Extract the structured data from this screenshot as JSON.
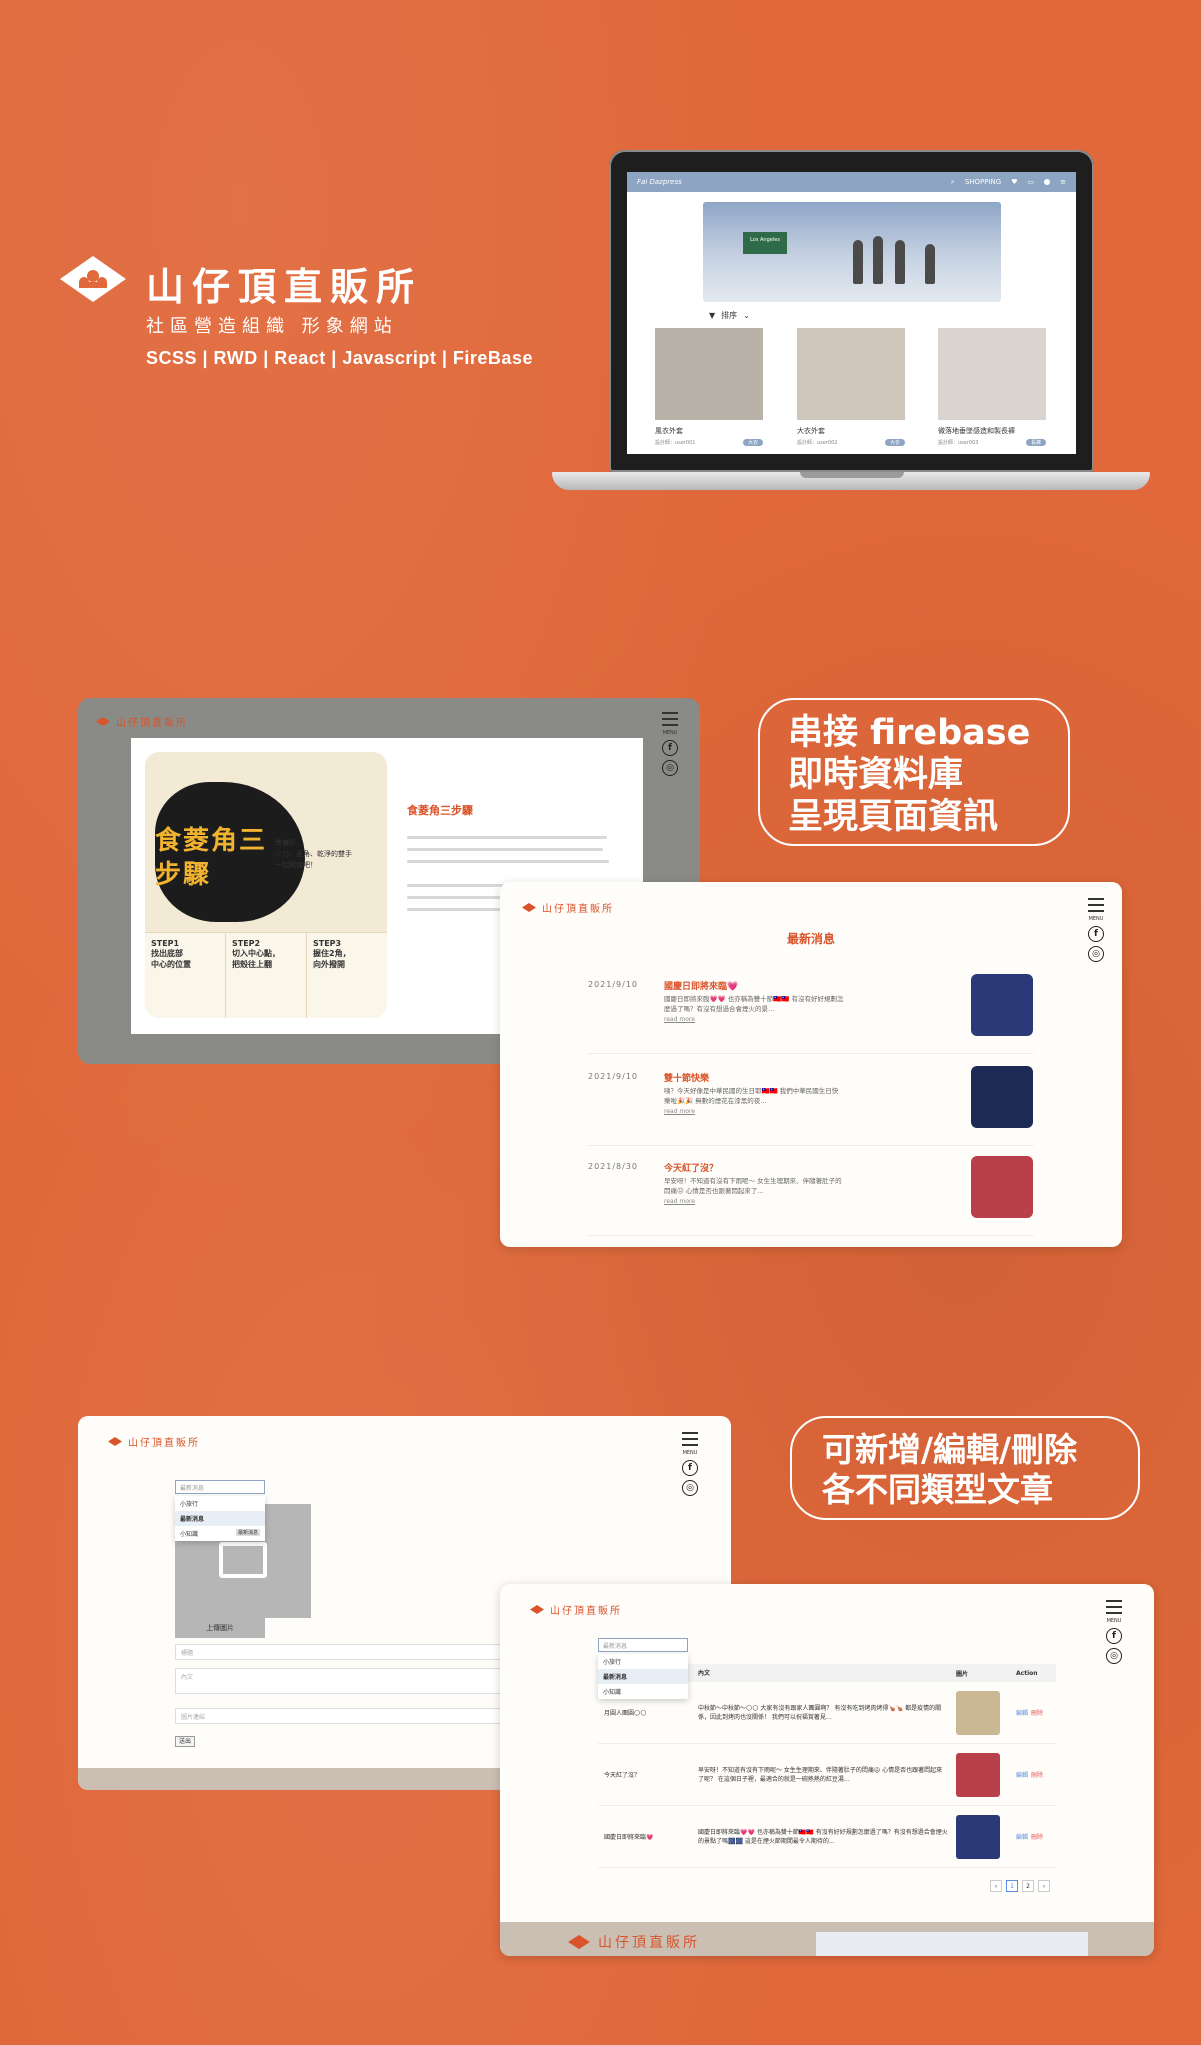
{
  "brand": {
    "title": "山仔頂直販所",
    "subtitle": "社區營造組織 形象網站",
    "tech": "SCSS | RWD | React | Javascript | FireBase"
  },
  "laptop": {
    "nav_logo": "Fai Dazpress",
    "nav_items": [
      "SHOPPING"
    ],
    "banner_sign": "Los Angeles",
    "filter_label": "排序",
    "cards": [
      {
        "name": "風衣外套",
        "designer": "設計師：user001",
        "tag": "大衣"
      },
      {
        "name": "大衣外套",
        "designer": "設計師：user002",
        "tag": "大衣"
      },
      {
        "name": "微落地垂墜感造和製長褲",
        "designer": "設計師：user003",
        "tag": "長褲"
      }
    ]
  },
  "section2": {
    "site_name": "山仔頂直販所",
    "menu_label": "MENU",
    "facebook_glyph": "f",
    "instagram_glyph": "◎",
    "food_card_title": "食菱角三步驟",
    "food_side_text": "準備好\n小刀、菱角、乾淨的雙手\n一起開始吧！",
    "steps": [
      "STEP1\n找出底部\n中心的位置",
      "STEP2\n切入中心點，\n把殼往上翻",
      "STEP3\n握住2角，\n向外撥開"
    ],
    "article_title": "食菱角三步驟",
    "callout": [
      "串接 firebase",
      "即時資料庫",
      "呈現頁面資訊"
    ]
  },
  "news": {
    "site_name": "山仔頂直販所",
    "menu_label": "MENU",
    "heading": "最新消息",
    "items": [
      {
        "date": "2021/9/10",
        "title": "國慶日即將來臨💗",
        "body": "國慶日即將來臨💗💗 也亦稱為雙十節🇹🇼🇹🇼 有沒有好好規劃怎麼過了嗎？有沒有想過合會煙火的景…",
        "more": "read more",
        "color": "#2a3a78"
      },
      {
        "date": "2021/9/10",
        "title": "雙十節快樂",
        "body": "咦？今天好像是中華民國的生日耶🇹🇼🇹🇼 我們中華民國生日快樂啦🎉🎉 無數的煙花在漆黑的夜…",
        "more": "read more",
        "color": "#1d2a54"
      },
      {
        "date": "2021/8/30",
        "title": "今天紅了沒？",
        "body": "早安呀！不知道有沒有下雨呢～ 女生生理期來、伴隨著肚子的悶痛😖 心情是否也跟著悶起來了…",
        "more": "read more",
        "color": "#b9404a"
      }
    ]
  },
  "section3": {
    "site_name": "山仔頂直販所",
    "menu_label": "MENU",
    "select_value": "最新消息",
    "dropdown_options": [
      "小旅行",
      "最新消息",
      "小知識"
    ],
    "dropdown_hint": "最新消息",
    "upload_label": "上傳圖片",
    "title_placeholder": "標題",
    "content_placeholder": "內文",
    "image_link_placeholder": "圖片連結",
    "send_label": "送出",
    "callout": [
      "可新增/編輯/刪除",
      "各不同類型文章"
    ],
    "table": {
      "headers": [
        "",
        "內文",
        "圖片",
        "Action"
      ],
      "rows": [
        {
          "title": "月圓人團圓🌕🌕",
          "body": "中秋節～中秋節～🌕🌕 大家有沒有跟家人團圓啊？ 有沒有吃到烤肉烤得🍗🍗 都是疫情的關係，因此到烤肉也沒關係！ 我們可以祝福賞著見…",
          "edit": "編輯",
          "delete": "刪除",
          "color": "#c9b893"
        },
        {
          "title": "今天紅了沒？",
          "body": "早安呀！不知道有沒有下雨呢～ 女生生理期來、伴隨著肚子的悶痛😖 心情是否也跟著悶起來了呢？ 在這個日子裡，最適合的就是一碗熱熱的紅豆湯…",
          "edit": "編輯",
          "delete": "刪除",
          "color": "#b9404a"
        },
        {
          "title": "國慶日即將來臨💗",
          "body": "國慶日即將來臨💗💗 也亦稱為雙十節🇹🇼🇹🇼 有沒有好好規劃怎麼過了嗎？有沒有想過合會煙火的景點了嗎🎆🎆 這是在煙火節期間最令人期待的…",
          "edit": "編輯",
          "delete": "刪除",
          "color": "#2a3a78"
        }
      ]
    },
    "pager": [
      "‹",
      "1",
      "2",
      "›"
    ],
    "footer_name": "山仔頂直販所"
  }
}
